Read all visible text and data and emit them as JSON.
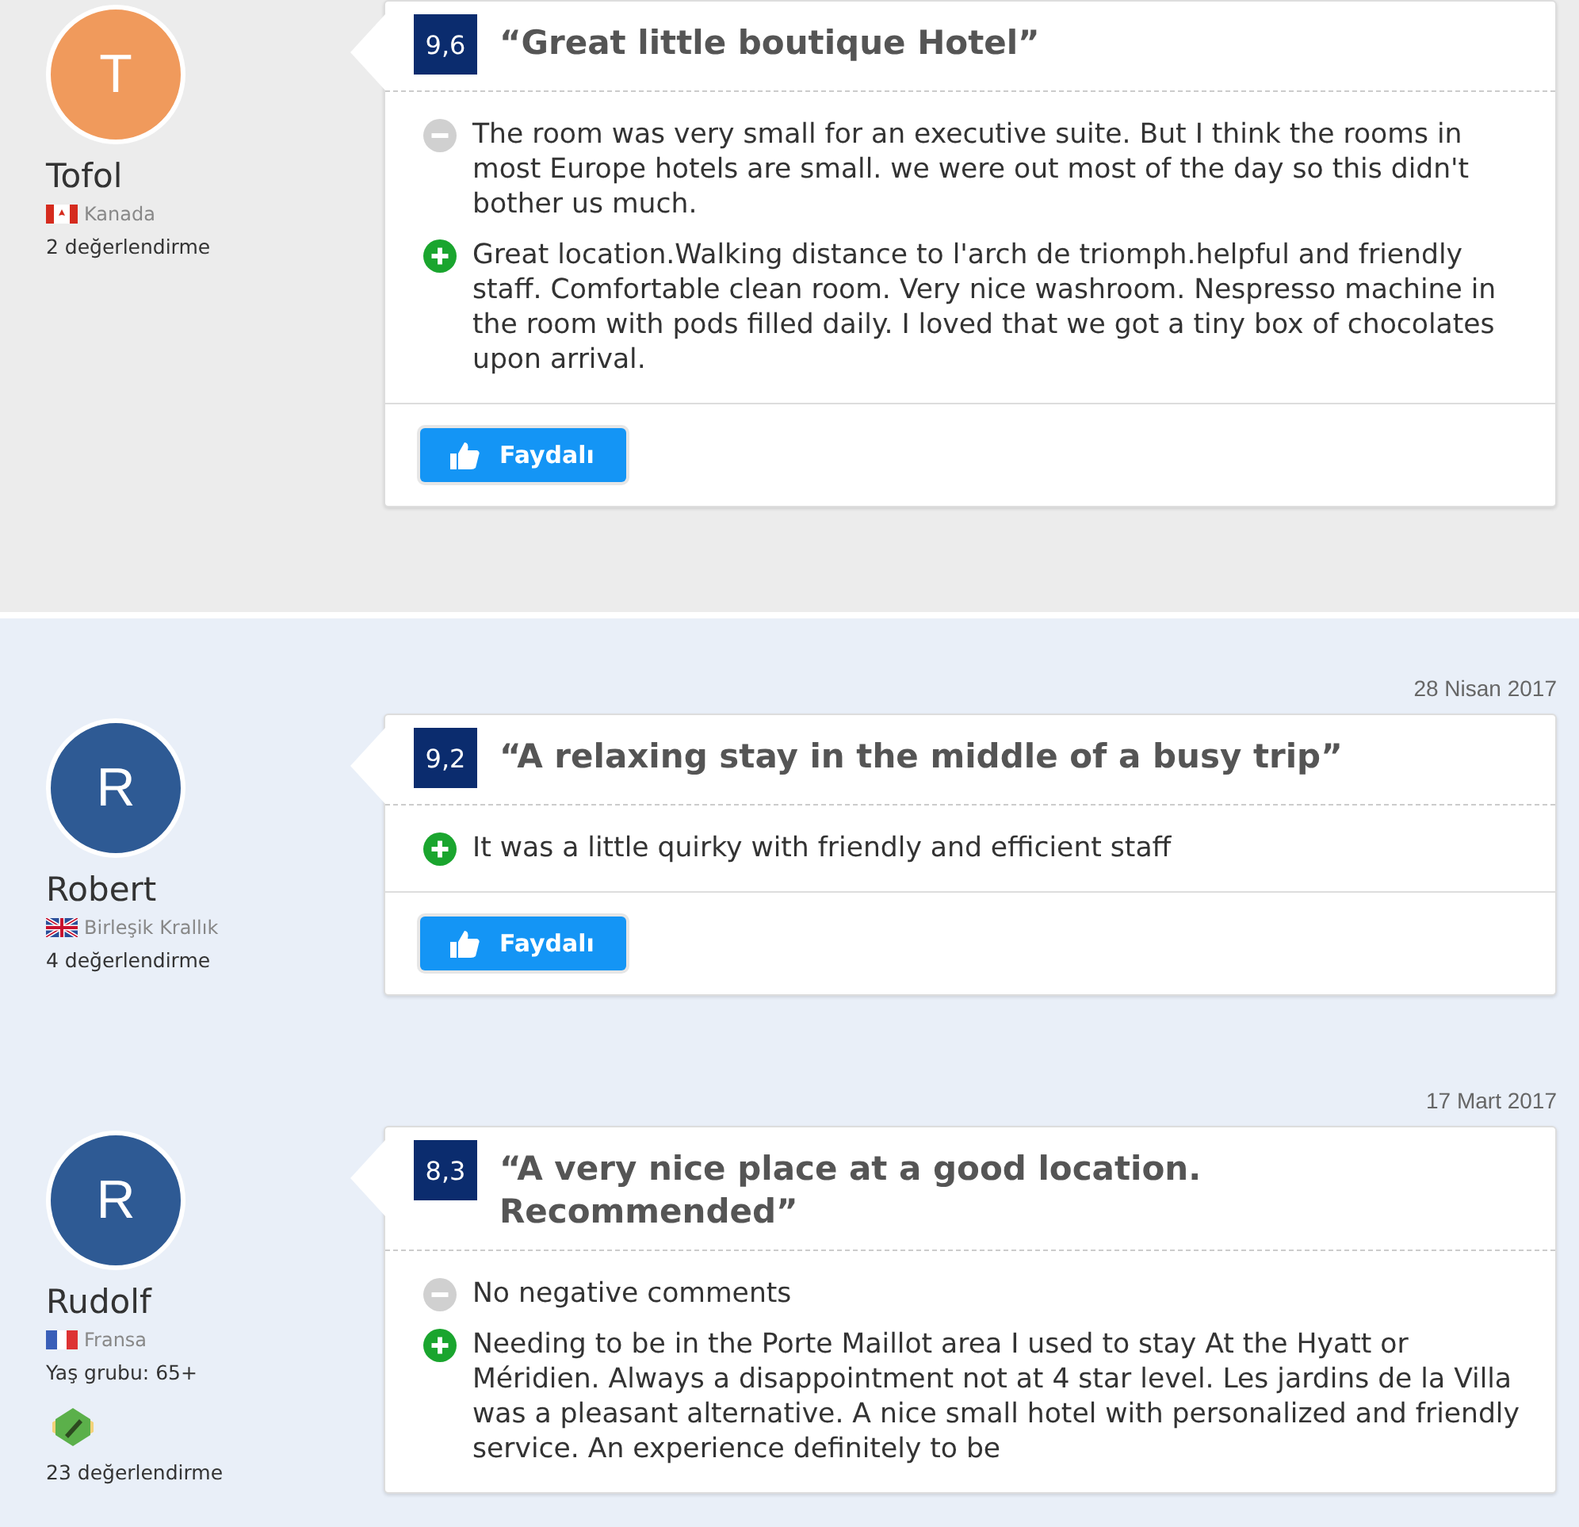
{
  "reviews": [
    {
      "color": "#ececec",
      "score": "9,6",
      "title": "“Great little boutique Hotel”",
      "reviewer": {
        "initial": "T",
        "color": "#f09a5c",
        "name": "Tofol",
        "flag": {
          "kind": "ca"
        },
        "country": "Kanada",
        "review_count": "2 değerlendirme"
      },
      "comments": [
        {
          "kind": "negative",
          "text": "The room was very small for an executive suite. But I think the rooms in most Europe hotels are small. we were out most of the day so this didn't bother us much."
        },
        {
          "kind": "positive",
          "text": "Great location.Walking distance to l'arch de triomph.helpful and friendly staff. Comfortable clean room. Very nice washroom. Nespresso machine in the room with pods filled daily. I loved that we got a tiny box of chocolates upon arrival."
        }
      ],
      "helpful_button": "Faydalı"
    },
    {
      "color": "#e9eff8",
      "date": "28 Nisan 2017",
      "score": "9,2",
      "title": "“A relaxing stay in the middle of a busy trip”",
      "reviewer": {
        "initial": "R",
        "color": "#2e5a94",
        "name": "Robert",
        "flag": {
          "kind": "gb"
        },
        "country": "Birleşik Krallık",
        "review_count": "4 değerlendirme"
      },
      "comments": [
        {
          "kind": "positive",
          "text": "It was a little quirky with friendly and efficient staff"
        }
      ],
      "helpful_button": "Faydalı"
    },
    {
      "color": "#e9eff8",
      "date": "17 Mart 2017",
      "score": "8,3",
      "title": "“A very nice place at a good location. Recommended”",
      "reviewer": {
        "initial": "R",
        "color": "#2e5a94",
        "name": "Rudolf",
        "flag": {
          "kind": "fr"
        },
        "country": "Fransa",
        "age_group": "Yaş grubu: 65+",
        "badge": true,
        "review_count": "23 değerlendirme"
      },
      "comments": [
        {
          "kind": "negative",
          "text": "No negative comments"
        },
        {
          "kind": "positive",
          "text": "Needing to be in the Porte Maillot area I used to stay At the Hyatt or Méridien. Always a disappointment not at 4 star level. Les jardins de la Villa was a pleasant alternative. A nice small hotel with personalized and friendly service. An experience definitely to be"
        }
      ]
    }
  ]
}
